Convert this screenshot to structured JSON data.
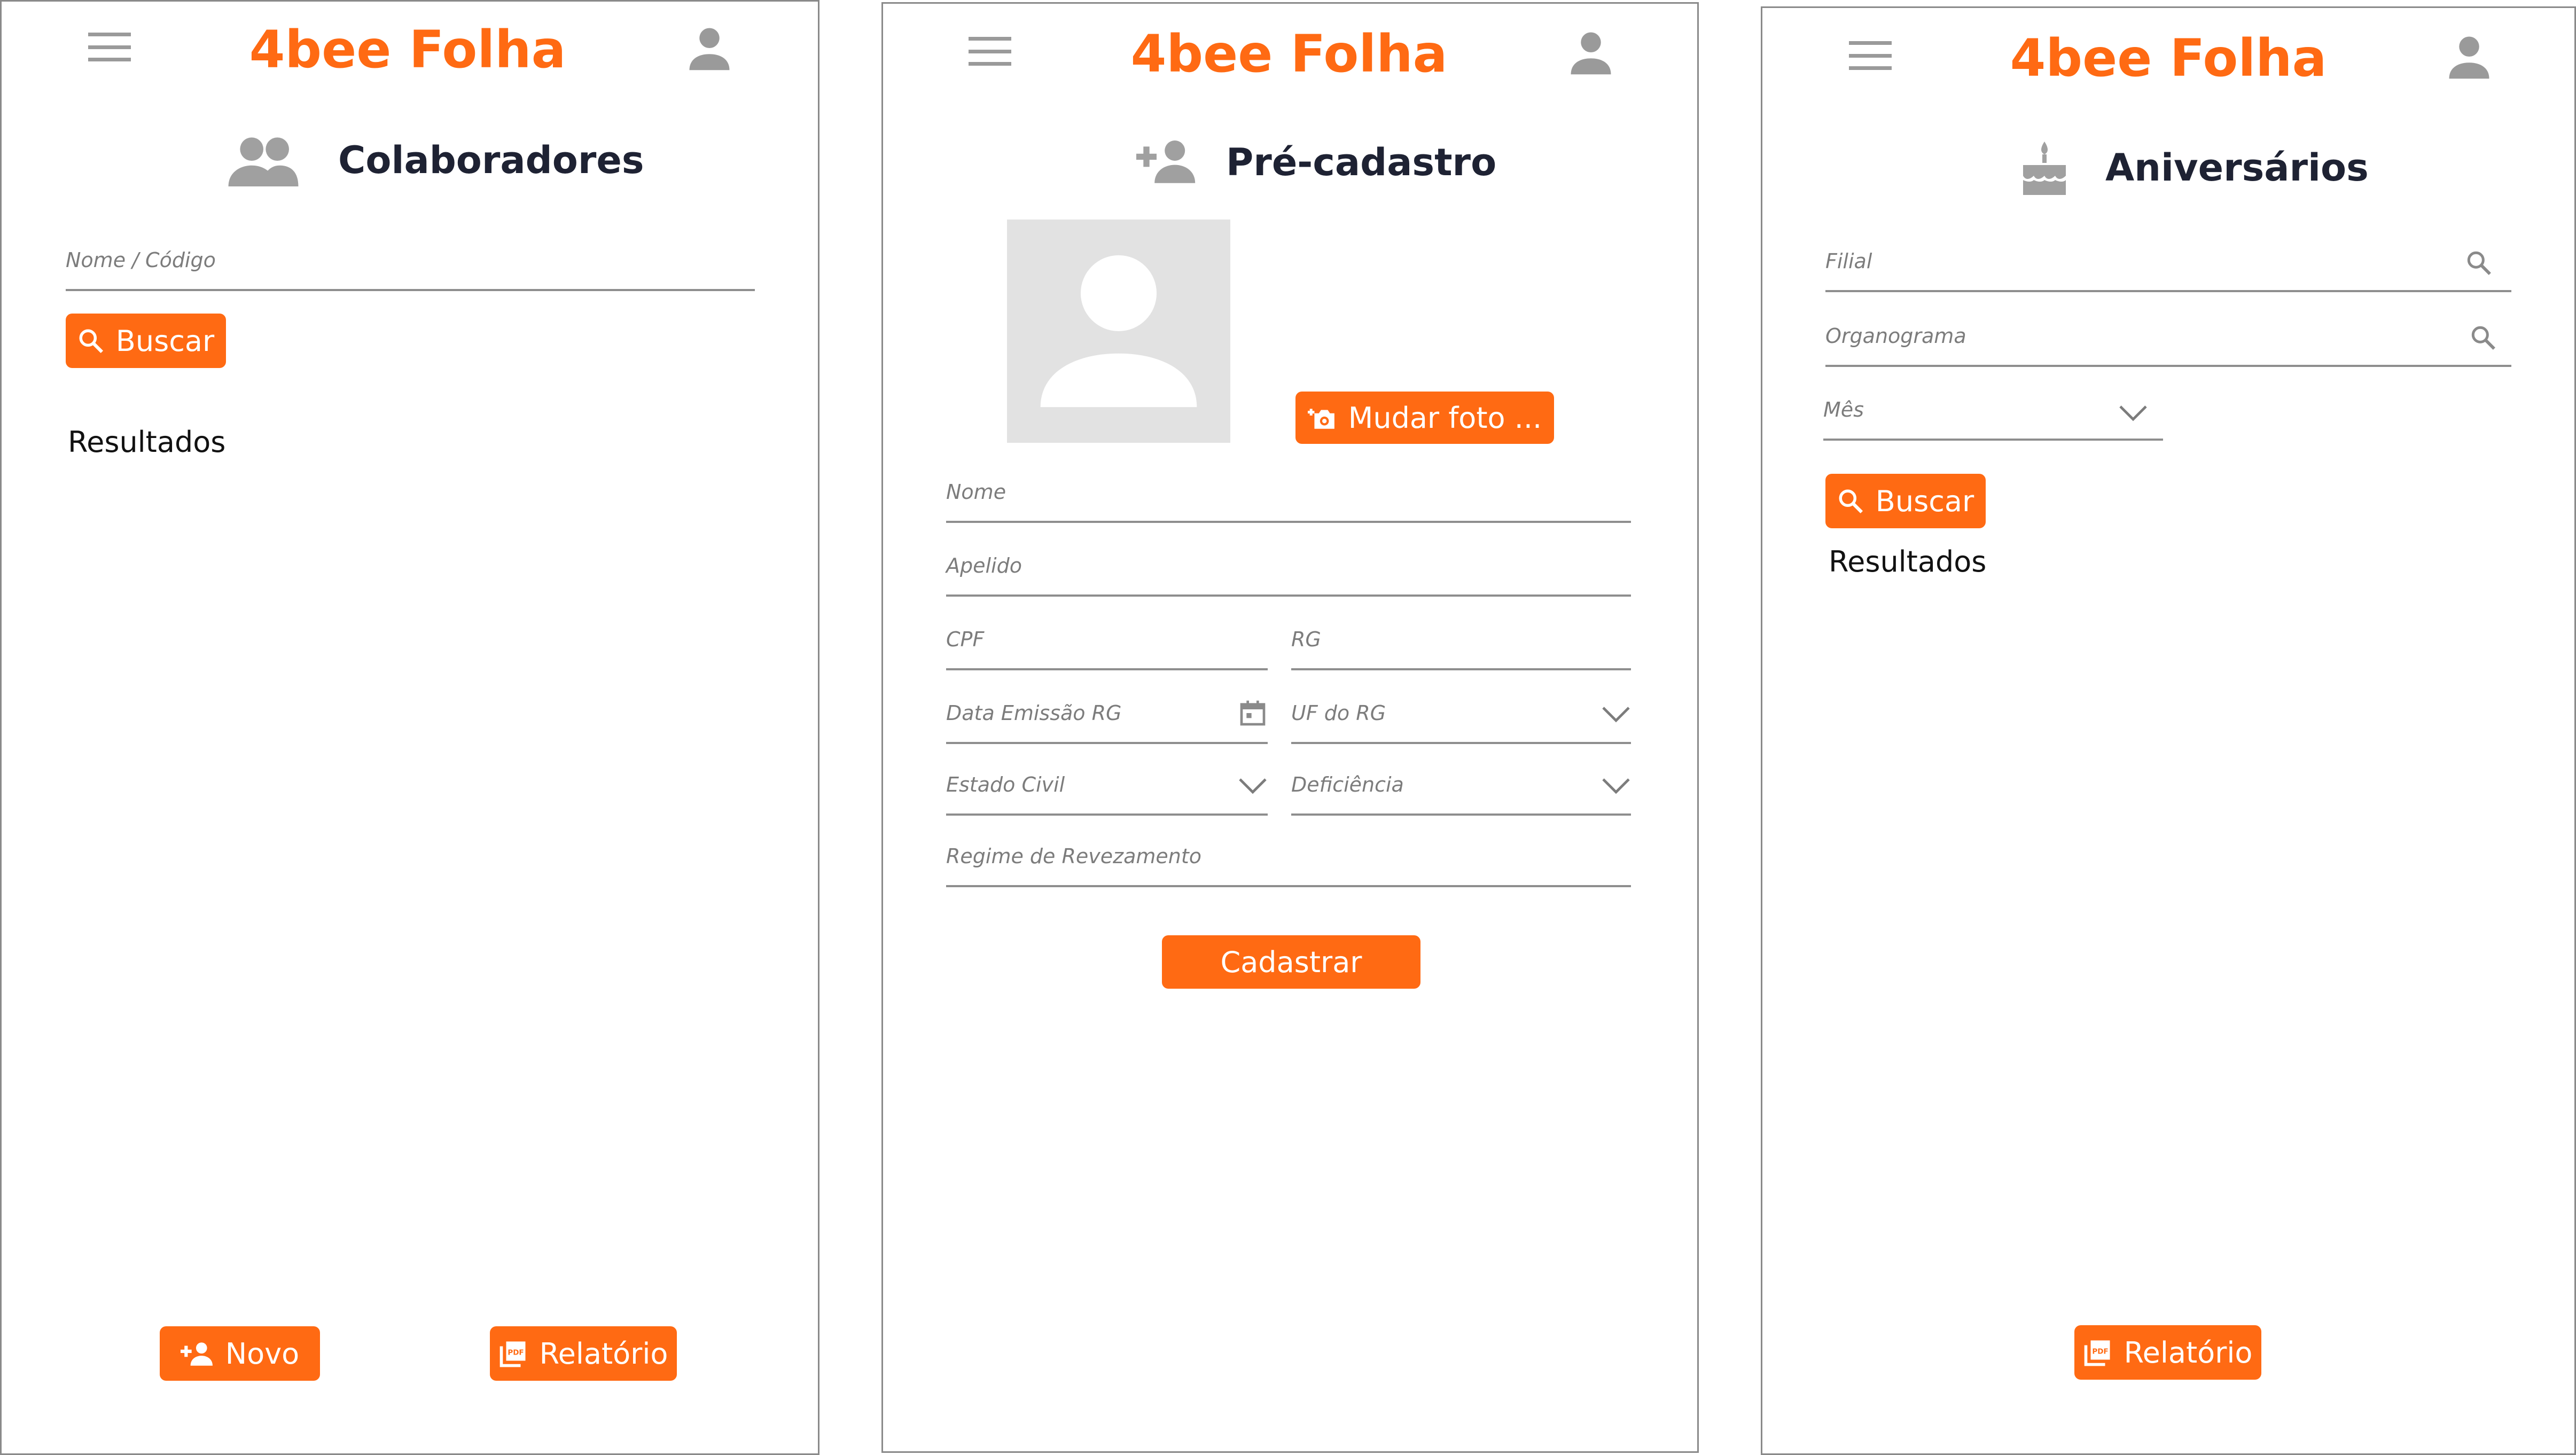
{
  "brand": "4bee Folha",
  "colors": {
    "accent": "#ff6a13",
    "icon_gray": "#9a9a9a",
    "border": "#8a8a8a"
  },
  "screen1": {
    "title": "Colaboradores",
    "title_icon": "group-icon",
    "search_placeholder": "Nome / Código",
    "search_button": "Buscar",
    "results_label": "Resultados",
    "new_button": "Novo",
    "report_button": "Relatório"
  },
  "screen2": {
    "title": "Pré-cadastro",
    "title_icon": "person-add-icon",
    "change_photo_button": "Mudar foto ...",
    "fields": {
      "nome": "Nome",
      "apelido": "Apelido",
      "cpf": "CPF",
      "rg": "RG",
      "data_emissao_rg": "Data Emissão RG",
      "uf_rg": "UF do RG",
      "estado_civil": "Estado Civil",
      "deficiencia": "Deficiência",
      "regime": "Regime de Revezamento"
    },
    "submit_button": "Cadastrar"
  },
  "screen3": {
    "title": "Aniversários",
    "title_icon": "cake-icon",
    "filial_placeholder": "Filial",
    "organograma_placeholder": "Organograma",
    "mes_placeholder": "Mês",
    "search_button": "Buscar",
    "results_label": "Resultados",
    "report_button": "Relatório"
  }
}
